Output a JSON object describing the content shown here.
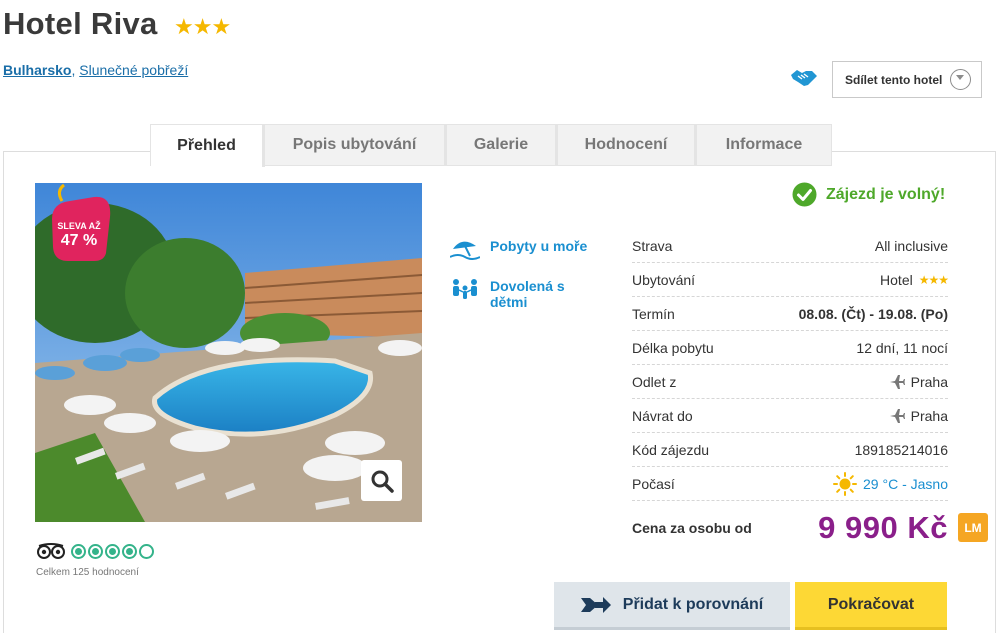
{
  "hotel": {
    "name": "Hotel Riva",
    "stars": "★★★"
  },
  "breadcrumb": {
    "country": "Bulharsko",
    "separator": ", ",
    "region": "Slunečné pobřeží"
  },
  "share": {
    "label": "Sdílet tento hotel"
  },
  "tabs": [
    {
      "label": "Přehled",
      "active": true
    },
    {
      "label": "Popis ubytování",
      "active": false
    },
    {
      "label": "Galerie",
      "active": false
    },
    {
      "label": "Hodnocení",
      "active": false
    },
    {
      "label": "Informace",
      "active": false
    }
  ],
  "discount_badge": {
    "line1": "SLEVA AŽ",
    "line2": "47 %"
  },
  "tripadvisor": {
    "rating_out_of_5": 4,
    "count_text": "Celkem 125 hodnocení"
  },
  "features": [
    {
      "icon": "beach-umbrella-icon",
      "label": "Pobyty u moře"
    },
    {
      "icon": "family-icon",
      "label": "Dovolená s dětmi"
    }
  ],
  "availability": {
    "label": "Zájezd je volný!"
  },
  "details": [
    {
      "label": "Strava",
      "value": "All inclusive"
    },
    {
      "label": "Ubytování",
      "value": "Hotel",
      "stars": "★★★"
    },
    {
      "label": "Termín",
      "value": "08.08. (Čt) - 19.08. (Po)",
      "bold": true
    },
    {
      "label": "Délka pobytu",
      "value": "12 dní, 11 nocí"
    },
    {
      "label": "Odlet z",
      "value": "Praha",
      "icon": "plane-icon"
    },
    {
      "label": "Návrat do",
      "value": "Praha",
      "icon": "plane-icon"
    },
    {
      "label": "Kód zájezdu",
      "value": "189185214016"
    },
    {
      "label": "Počasí",
      "value": "29 °C - Jasno",
      "icon": "sun-icon",
      "blue": true
    }
  ],
  "price": {
    "label": "Cena za osobu od",
    "value": "9 990 Kč",
    "badge": "LM"
  },
  "buttons": {
    "compare": "Přidat k porovnání",
    "continue": "Pokračovat"
  },
  "colors": {
    "price": "#8a1f8a",
    "link": "#1a8fd0",
    "available": "#4ea82a",
    "star": "#f5b800",
    "continue": "#fdd835",
    "badge": "#e0245e"
  }
}
